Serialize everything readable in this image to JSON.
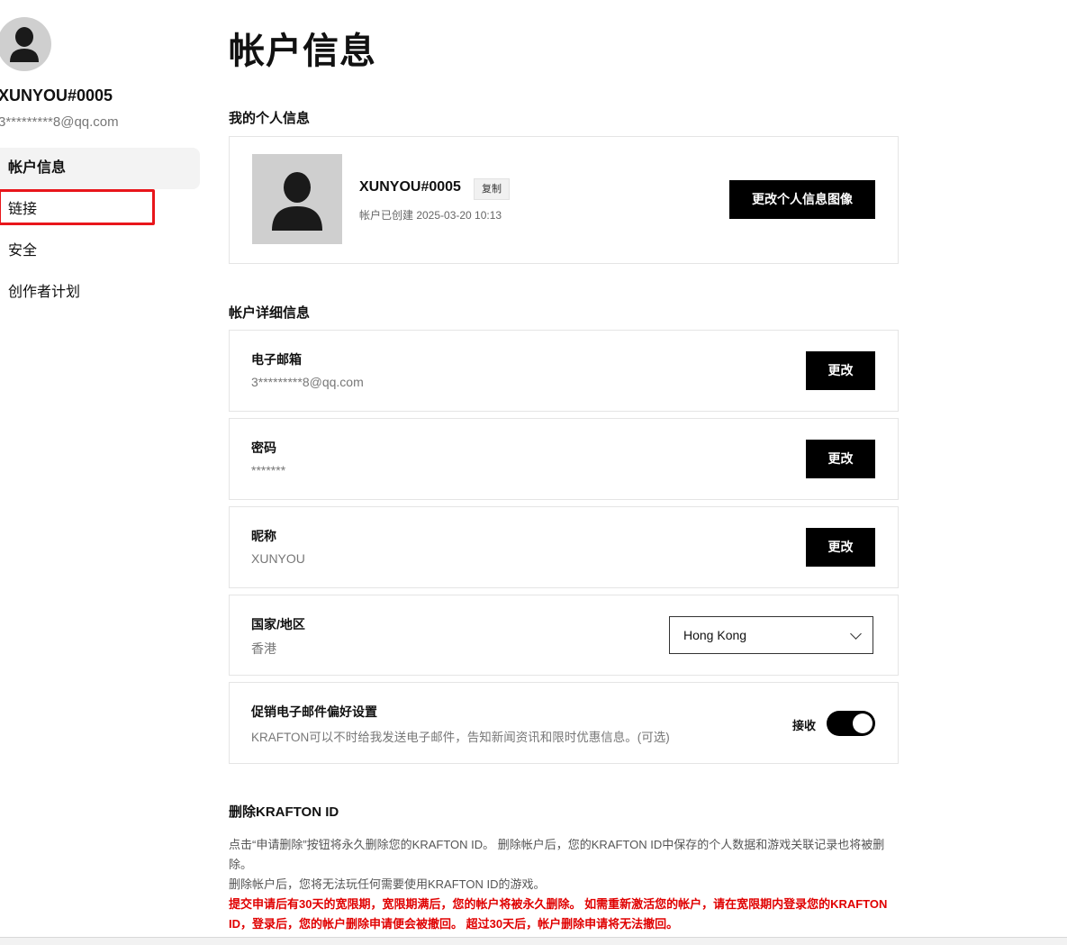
{
  "sidebar": {
    "username": "XUNYOU#0005",
    "email": "3*********8@qq.com",
    "items": [
      {
        "label": "帐户信息"
      },
      {
        "label": "链接"
      },
      {
        "label": "安全"
      },
      {
        "label": "创作者计划"
      }
    ]
  },
  "main": {
    "title": "帐户信息",
    "personal_section": "我的个人信息",
    "profile": {
      "name": "XUNYOU#0005",
      "copy_label": "复制",
      "created": "帐户已创建 2025-03-20 10:13",
      "change_image_label": "更改个人信息图像"
    },
    "details_section": "帐户详细信息",
    "rows": [
      {
        "title": "电子邮箱",
        "value": "3*********8@qq.com",
        "button": "更改"
      },
      {
        "title": "密码",
        "value": "*******",
        "button": "更改"
      },
      {
        "title": "昵称",
        "value": "XUNYOU",
        "button": "更改"
      }
    ],
    "country": {
      "title": "国家/地区",
      "value": "香港",
      "selected": "Hong Kong"
    },
    "promo": {
      "title": "促销电子邮件偏好设置",
      "desc": "KRAFTON可以不时给我发送电子邮件，告知新闻资讯和限时优惠信息。(可选)",
      "receive_label": "接收",
      "enabled": true
    },
    "delete": {
      "title": "删除KRAFTON ID",
      "para1": "点击“申请删除”按钮将永久删除您的KRAFTON ID。 删除帐户后，您的KRAFTON ID中保存的个人数据和游戏关联记录也将被删除。",
      "para2": "删除帐户后，您将无法玩任何需要使用KRAFTON ID的游戏。",
      "warning": "提交申请后有30天的宽限期，宽限期满后，您的帐户将被永久删除。 如需重新激活您的帐户，请在宽限期内登录您的KRAFTON ID，登录后，您的帐户删除申请便会被撤回。 超过30天后，帐户删除申请将无法撤回。"
    }
  },
  "colors": {
    "highlight": "#e8161b",
    "warning": "#e00000",
    "button": "#000000"
  }
}
